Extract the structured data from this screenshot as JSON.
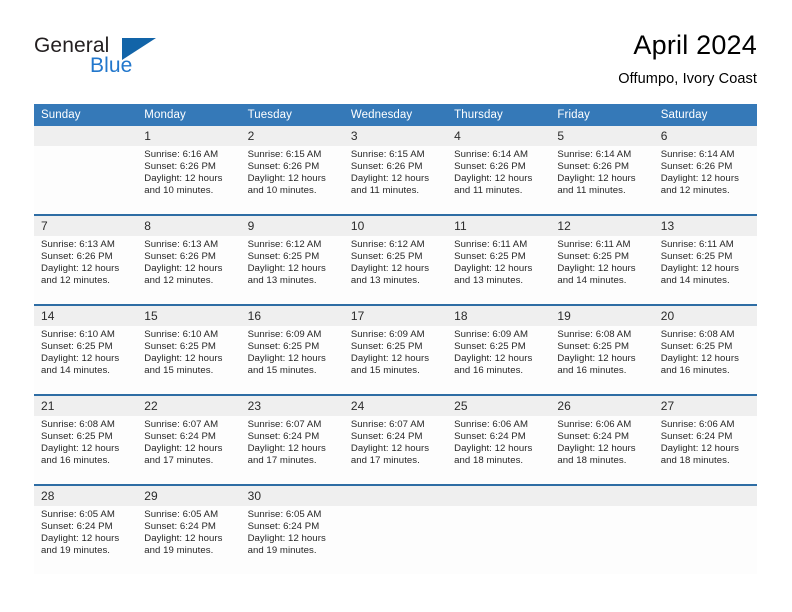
{
  "brand": {
    "name_part1": "General",
    "name_part2": "Blue",
    "flag_icon": "triangle-flag-icon"
  },
  "header": {
    "title": "April 2024",
    "location": "Offumpo, Ivory Coast"
  },
  "colors": {
    "header_blue": "#3579b8",
    "separator_blue": "#2e6da4",
    "daynum_gray": "#efefef",
    "brand_blue": "#2277cc",
    "flag_blue": "#1264a8"
  },
  "weekdays": [
    "Sunday",
    "Monday",
    "Tuesday",
    "Wednesday",
    "Thursday",
    "Friday",
    "Saturday"
  ],
  "labels": {
    "sunrise_prefix": "Sunrise:",
    "sunset_prefix": "Sunset:",
    "daylight_prefix": "Daylight:"
  },
  "weeks": [
    {
      "days": [
        {
          "num": "",
          "l1": "",
          "l2": "",
          "l3": "",
          "l4": ""
        },
        {
          "num": "1",
          "l1": "Sunrise: 6:16 AM",
          "l2": "Sunset: 6:26 PM",
          "l3": "Daylight: 12 hours",
          "l4": "and 10 minutes."
        },
        {
          "num": "2",
          "l1": "Sunrise: 6:15 AM",
          "l2": "Sunset: 6:26 PM",
          "l3": "Daylight: 12 hours",
          "l4": "and 10 minutes."
        },
        {
          "num": "3",
          "l1": "Sunrise: 6:15 AM",
          "l2": "Sunset: 6:26 PM",
          "l3": "Daylight: 12 hours",
          "l4": "and 11 minutes."
        },
        {
          "num": "4",
          "l1": "Sunrise: 6:14 AM",
          "l2": "Sunset: 6:26 PM",
          "l3": "Daylight: 12 hours",
          "l4": "and 11 minutes."
        },
        {
          "num": "5",
          "l1": "Sunrise: 6:14 AM",
          "l2": "Sunset: 6:26 PM",
          "l3": "Daylight: 12 hours",
          "l4": "and 11 minutes."
        },
        {
          "num": "6",
          "l1": "Sunrise: 6:14 AM",
          "l2": "Sunset: 6:26 PM",
          "l3": "Daylight: 12 hours",
          "l4": "and 12 minutes."
        }
      ]
    },
    {
      "days": [
        {
          "num": "7",
          "l1": "Sunrise: 6:13 AM",
          "l2": "Sunset: 6:26 PM",
          "l3": "Daylight: 12 hours",
          "l4": "and 12 minutes."
        },
        {
          "num": "8",
          "l1": "Sunrise: 6:13 AM",
          "l2": "Sunset: 6:26 PM",
          "l3": "Daylight: 12 hours",
          "l4": "and 12 minutes."
        },
        {
          "num": "9",
          "l1": "Sunrise: 6:12 AM",
          "l2": "Sunset: 6:25 PM",
          "l3": "Daylight: 12 hours",
          "l4": "and 13 minutes."
        },
        {
          "num": "10",
          "l1": "Sunrise: 6:12 AM",
          "l2": "Sunset: 6:25 PM",
          "l3": "Daylight: 12 hours",
          "l4": "and 13 minutes."
        },
        {
          "num": "11",
          "l1": "Sunrise: 6:11 AM",
          "l2": "Sunset: 6:25 PM",
          "l3": "Daylight: 12 hours",
          "l4": "and 13 minutes."
        },
        {
          "num": "12",
          "l1": "Sunrise: 6:11 AM",
          "l2": "Sunset: 6:25 PM",
          "l3": "Daylight: 12 hours",
          "l4": "and 14 minutes."
        },
        {
          "num": "13",
          "l1": "Sunrise: 6:11 AM",
          "l2": "Sunset: 6:25 PM",
          "l3": "Daylight: 12 hours",
          "l4": "and 14 minutes."
        }
      ]
    },
    {
      "days": [
        {
          "num": "14",
          "l1": "Sunrise: 6:10 AM",
          "l2": "Sunset: 6:25 PM",
          "l3": "Daylight: 12 hours",
          "l4": "and 14 minutes."
        },
        {
          "num": "15",
          "l1": "Sunrise: 6:10 AM",
          "l2": "Sunset: 6:25 PM",
          "l3": "Daylight: 12 hours",
          "l4": "and 15 minutes."
        },
        {
          "num": "16",
          "l1": "Sunrise: 6:09 AM",
          "l2": "Sunset: 6:25 PM",
          "l3": "Daylight: 12 hours",
          "l4": "and 15 minutes."
        },
        {
          "num": "17",
          "l1": "Sunrise: 6:09 AM",
          "l2": "Sunset: 6:25 PM",
          "l3": "Daylight: 12 hours",
          "l4": "and 15 minutes."
        },
        {
          "num": "18",
          "l1": "Sunrise: 6:09 AM",
          "l2": "Sunset: 6:25 PM",
          "l3": "Daylight: 12 hours",
          "l4": "and 16 minutes."
        },
        {
          "num": "19",
          "l1": "Sunrise: 6:08 AM",
          "l2": "Sunset: 6:25 PM",
          "l3": "Daylight: 12 hours",
          "l4": "and 16 minutes."
        },
        {
          "num": "20",
          "l1": "Sunrise: 6:08 AM",
          "l2": "Sunset: 6:25 PM",
          "l3": "Daylight: 12 hours",
          "l4": "and 16 minutes."
        }
      ]
    },
    {
      "days": [
        {
          "num": "21",
          "l1": "Sunrise: 6:08 AM",
          "l2": "Sunset: 6:25 PM",
          "l3": "Daylight: 12 hours",
          "l4": "and 16 minutes."
        },
        {
          "num": "22",
          "l1": "Sunrise: 6:07 AM",
          "l2": "Sunset: 6:24 PM",
          "l3": "Daylight: 12 hours",
          "l4": "and 17 minutes."
        },
        {
          "num": "23",
          "l1": "Sunrise: 6:07 AM",
          "l2": "Sunset: 6:24 PM",
          "l3": "Daylight: 12 hours",
          "l4": "and 17 minutes."
        },
        {
          "num": "24",
          "l1": "Sunrise: 6:07 AM",
          "l2": "Sunset: 6:24 PM",
          "l3": "Daylight: 12 hours",
          "l4": "and 17 minutes."
        },
        {
          "num": "25",
          "l1": "Sunrise: 6:06 AM",
          "l2": "Sunset: 6:24 PM",
          "l3": "Daylight: 12 hours",
          "l4": "and 18 minutes."
        },
        {
          "num": "26",
          "l1": "Sunrise: 6:06 AM",
          "l2": "Sunset: 6:24 PM",
          "l3": "Daylight: 12 hours",
          "l4": "and 18 minutes."
        },
        {
          "num": "27",
          "l1": "Sunrise: 6:06 AM",
          "l2": "Sunset: 6:24 PM",
          "l3": "Daylight: 12 hours",
          "l4": "and 18 minutes."
        }
      ]
    },
    {
      "days": [
        {
          "num": "28",
          "l1": "Sunrise: 6:05 AM",
          "l2": "Sunset: 6:24 PM",
          "l3": "Daylight: 12 hours",
          "l4": "and 19 minutes."
        },
        {
          "num": "29",
          "l1": "Sunrise: 6:05 AM",
          "l2": "Sunset: 6:24 PM",
          "l3": "Daylight: 12 hours",
          "l4": "and 19 minutes."
        },
        {
          "num": "30",
          "l1": "Sunrise: 6:05 AM",
          "l2": "Sunset: 6:24 PM",
          "l3": "Daylight: 12 hours",
          "l4": "and 19 minutes."
        },
        {
          "num": "",
          "l1": "",
          "l2": "",
          "l3": "",
          "l4": ""
        },
        {
          "num": "",
          "l1": "",
          "l2": "",
          "l3": "",
          "l4": ""
        },
        {
          "num": "",
          "l1": "",
          "l2": "",
          "l3": "",
          "l4": ""
        },
        {
          "num": "",
          "l1": "",
          "l2": "",
          "l3": "",
          "l4": ""
        }
      ]
    }
  ]
}
